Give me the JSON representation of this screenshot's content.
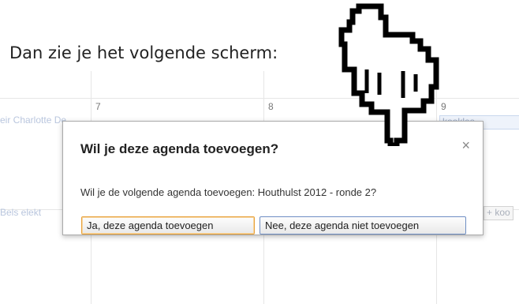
{
  "intro_text": "Dan zie je het volgende scherm:",
  "calendar": {
    "days": [
      "7",
      "8",
      "9"
    ],
    "events": {
      "row1_left": "eir Charlotte De",
      "row1_right": "kookles",
      "row2_left": "Bels elekt",
      "row2_right": "+ koo"
    }
  },
  "dialog": {
    "title": "Wil je deze agenda toevoegen?",
    "close_glyph": "×",
    "message": "Wil je de volgende agenda toevoegen: Houthulst 2012 - ronde 2?",
    "confirm_label": "Ja, deze agenda toevoegen",
    "cancel_label": "Nee, deze agenda niet toevoegen"
  },
  "icons": {
    "pointer": "pointing-hand-icon"
  }
}
